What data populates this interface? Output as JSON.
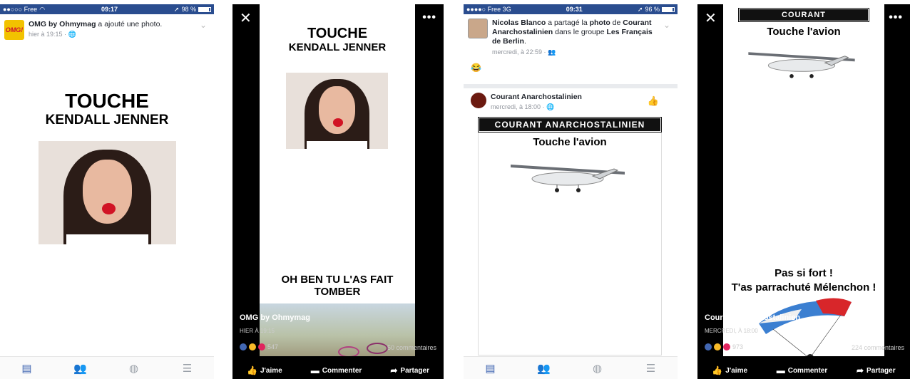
{
  "panel1": {
    "status": {
      "carrier": "●●○○○ Free",
      "time": "09:17",
      "battery": "98 %",
      "battery_level": 0.98
    },
    "post": {
      "author": "OMG by Ohmymag",
      "action": " a ajouté une photo.",
      "meta": "hier à 19:15 · 🌐",
      "avatar_text": "OMG!"
    },
    "image": {
      "title": "TOUCHE",
      "subtitle": "KENDALL JENNER"
    },
    "tabs": [
      "news-feed-icon",
      "friends-icon",
      "globe-icon",
      "menu-icon"
    ]
  },
  "panel2": {
    "close": "✕",
    "more": "•••",
    "image": {
      "title": "TOUCHE",
      "subtitle": "KENDALL JENNER",
      "bottom": "OH BEN TU L'AS FAIT TOMBER"
    },
    "author": "OMG by Ohmymag",
    "time": "HIER À 19:15",
    "reactions": "547",
    "comments": "50 commentaires",
    "actions": {
      "like": "J'aime",
      "comment": "Commenter",
      "share": "Partager"
    }
  },
  "panel3": {
    "status": {
      "carrier": "●●●●○ Free 3G",
      "time": "09:31",
      "battery": "96 %",
      "battery_level": 0.96
    },
    "share": {
      "author": "Nicolas Blanco",
      "t1": " a partagé la ",
      "photo": "photo",
      "t2": " de ",
      "page": "Courant Anarchostalinien",
      "t3": " dans le groupe ",
      "group": "Les Français de Berlin",
      "t4": ".",
      "meta": "mercredi, à 22:59 · 👥",
      "emoji": "😂"
    },
    "inner": {
      "author": "Courant Anarchostalinien",
      "meta": "mercredi, à 18:00 · 🌐"
    },
    "image": {
      "banner": "COURANT ANARCHOSTALINIEN",
      "title": "Touche l'avion"
    },
    "tabs": [
      "news-feed-icon",
      "friends-icon",
      "globe-icon",
      "menu-icon"
    ]
  },
  "panel4": {
    "close": "✕",
    "more": "•••",
    "image": {
      "banner": "COURANT ANARCHOSTALINIEN",
      "title": "Touche l'avion",
      "line1": "Pas si fort !",
      "line2": "T'as parrachuté Mélenchon !"
    },
    "author": "Courant Anarchostalinien",
    "time": "MERCREDI, À 18:00",
    "reactions": "973",
    "comments": "224 commentaires",
    "actions": {
      "like": "J'aime",
      "comment": "Commenter",
      "share": "Partager"
    }
  },
  "colors": {
    "fb_blue": "#4267b2",
    "status_blue": "#2a4d8f",
    "lips_red": "#d11324"
  }
}
